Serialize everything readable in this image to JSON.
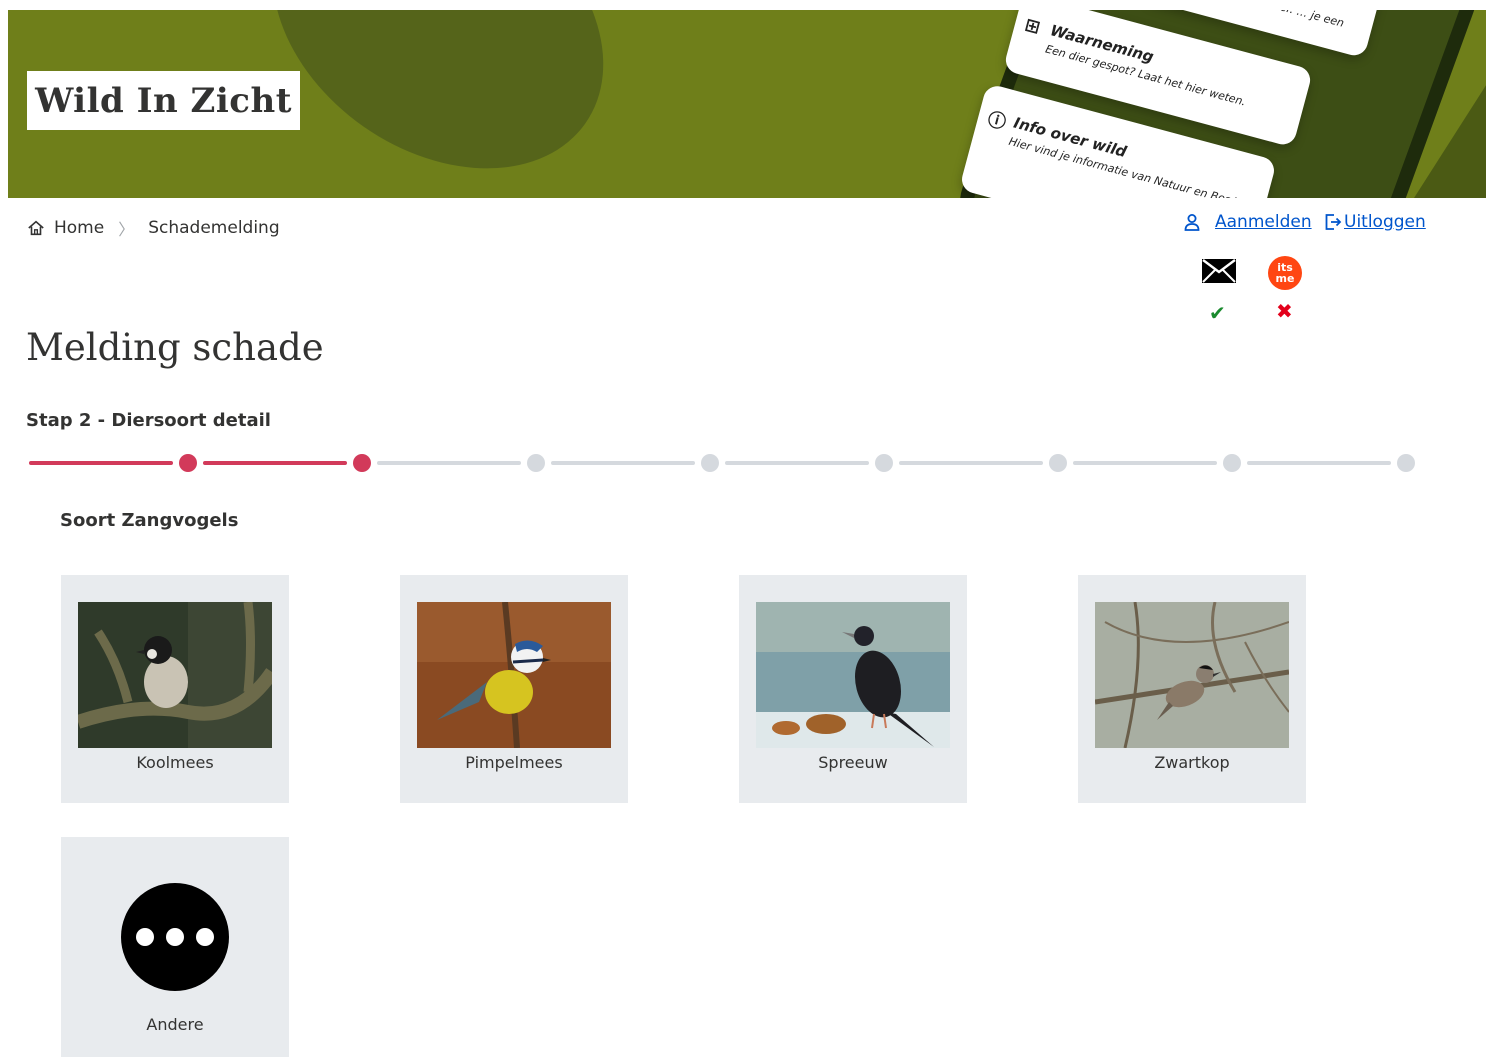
{
  "banner": {
    "logo_text": "Wild In Zicht",
    "card_top_text": "… het hier. … je een",
    "card_waarneming_title": "Waarneming",
    "card_waarneming_sub": "Een dier gespot? Laat het hier weten.",
    "card_info_title": "Info over wild",
    "card_info_sub": "Hier vind je informatie van Natuur en Bos Vla…",
    "colors": {
      "background": "#6f7f1a",
      "phone": "#1e2b0c"
    }
  },
  "breadcrumb": {
    "home_label": "Home",
    "current_label": "Schademelding"
  },
  "auth": {
    "login_label": "Aanmelden",
    "logout_label": "Uitloggen",
    "email_status_icon": "check-icon",
    "itsme_label": "its me",
    "itsme_status_icon": "cross-icon"
  },
  "page": {
    "title": "Melding schade",
    "step_title": "Stap 2 - Diersoort detail",
    "progress": {
      "total_steps": 8,
      "current_step": 2,
      "accent": "#d23a5a"
    },
    "section_title": "Soort Zangvogels"
  },
  "species": [
    {
      "label": "Koolmees"
    },
    {
      "label": "Pimpelmees"
    },
    {
      "label": "Spreeuw"
    },
    {
      "label": "Zwartkop"
    },
    {
      "label": "Andere"
    }
  ]
}
